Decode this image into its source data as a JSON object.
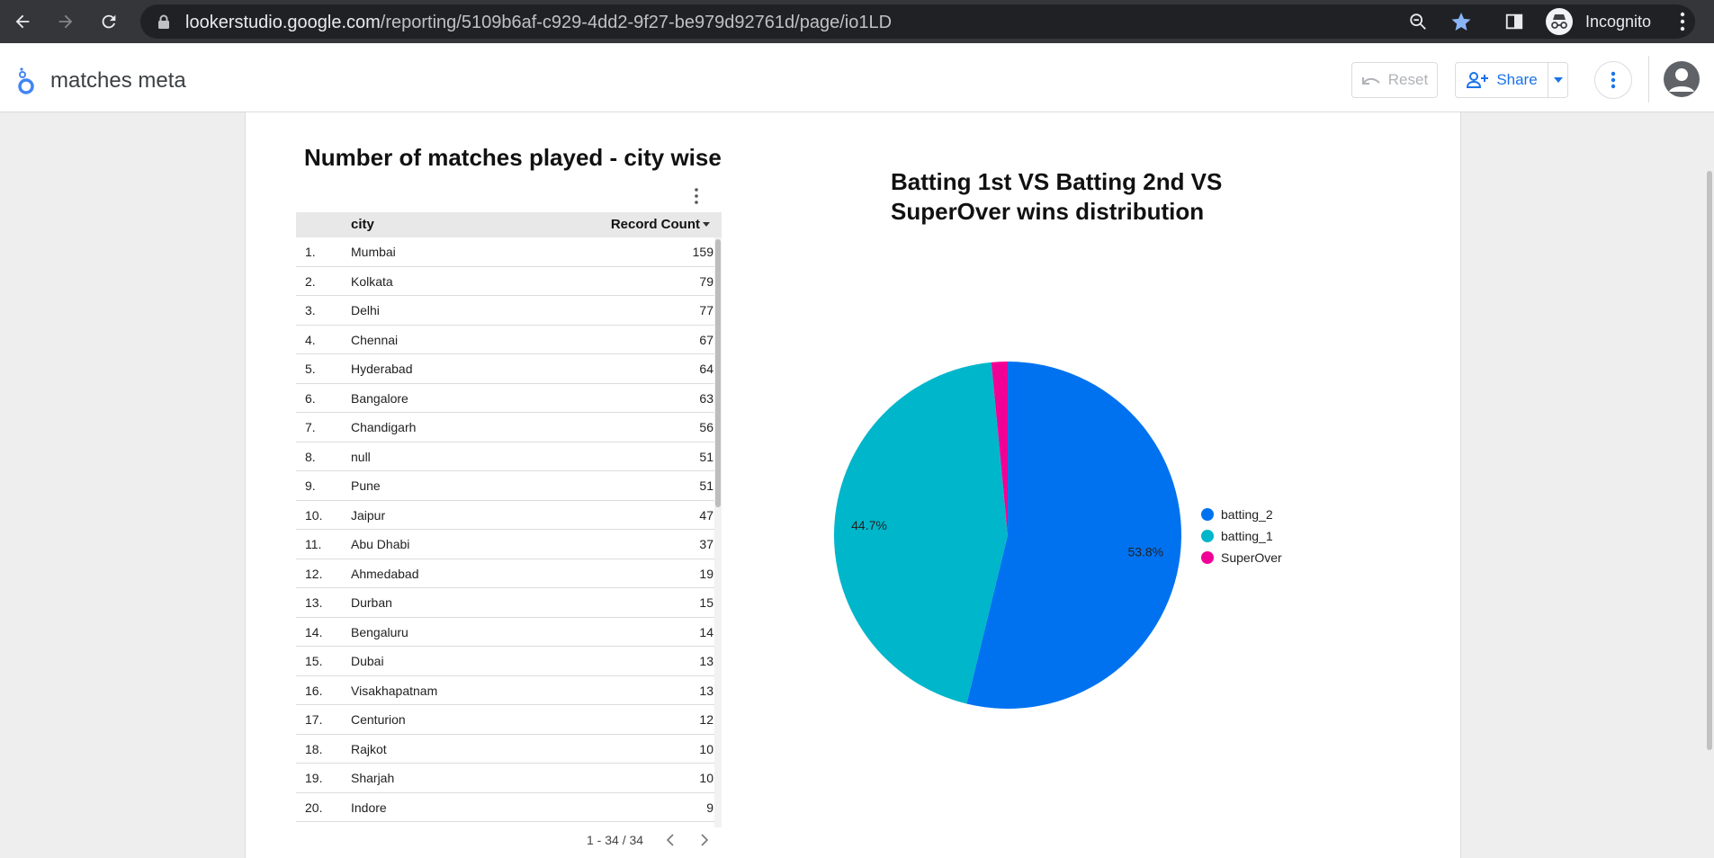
{
  "browser": {
    "url_host": "lookerstudio.google.com",
    "url_path": "/reporting/5109b6af-c929-4dd2-9f27-be979d92761d/page/io1LD",
    "profile_label": "Incognito"
  },
  "header": {
    "report_title": "matches meta",
    "reset_label": "Reset",
    "share_label": "Share"
  },
  "table": {
    "title": "Number of matches played - city wise",
    "columns": [
      "city",
      "Record Count"
    ],
    "rows": [
      [
        "1.",
        "Mumbai",
        "159"
      ],
      [
        "2.",
        "Kolkata",
        "79"
      ],
      [
        "3.",
        "Delhi",
        "77"
      ],
      [
        "4.",
        "Chennai",
        "67"
      ],
      [
        "5.",
        "Hyderabad",
        "64"
      ],
      [
        "6.",
        "Bangalore",
        "63"
      ],
      [
        "7.",
        "Chandigarh",
        "56"
      ],
      [
        "8.",
        "null",
        "51"
      ],
      [
        "9.",
        "Pune",
        "51"
      ],
      [
        "10.",
        "Jaipur",
        "47"
      ],
      [
        "11.",
        "Abu Dhabi",
        "37"
      ],
      [
        "12.",
        "Ahmedabad",
        "19"
      ],
      [
        "13.",
        "Durban",
        "15"
      ],
      [
        "14.",
        "Bengaluru",
        "14"
      ],
      [
        "15.",
        "Dubai",
        "13"
      ],
      [
        "16.",
        "Visakhapatnam",
        "13"
      ],
      [
        "17.",
        "Centurion",
        "12"
      ],
      [
        "18.",
        "Rajkot",
        "10"
      ],
      [
        "19.",
        "Sharjah",
        "10"
      ],
      [
        "20.",
        "Indore",
        "9"
      ]
    ],
    "pagination": "1 - 34 / 34"
  },
  "pie": {
    "title": "Batting 1st  VS  Batting 2nd  VS SuperOver wins distribution",
    "slice_labels": [
      "53.8%",
      "44.7%",
      ""
    ]
  },
  "chart_data": {
    "type": "pie",
    "title": "Batting 1st  VS  Batting 2nd  VS SuperOver wins distribution",
    "categories": [
      "batting_2",
      "batting_1",
      "SuperOver"
    ],
    "values": [
      53.8,
      44.7,
      1.5
    ],
    "colors": [
      "#0072f0",
      "#00b6cb",
      "#f10096"
    ],
    "legend_position": "right"
  }
}
